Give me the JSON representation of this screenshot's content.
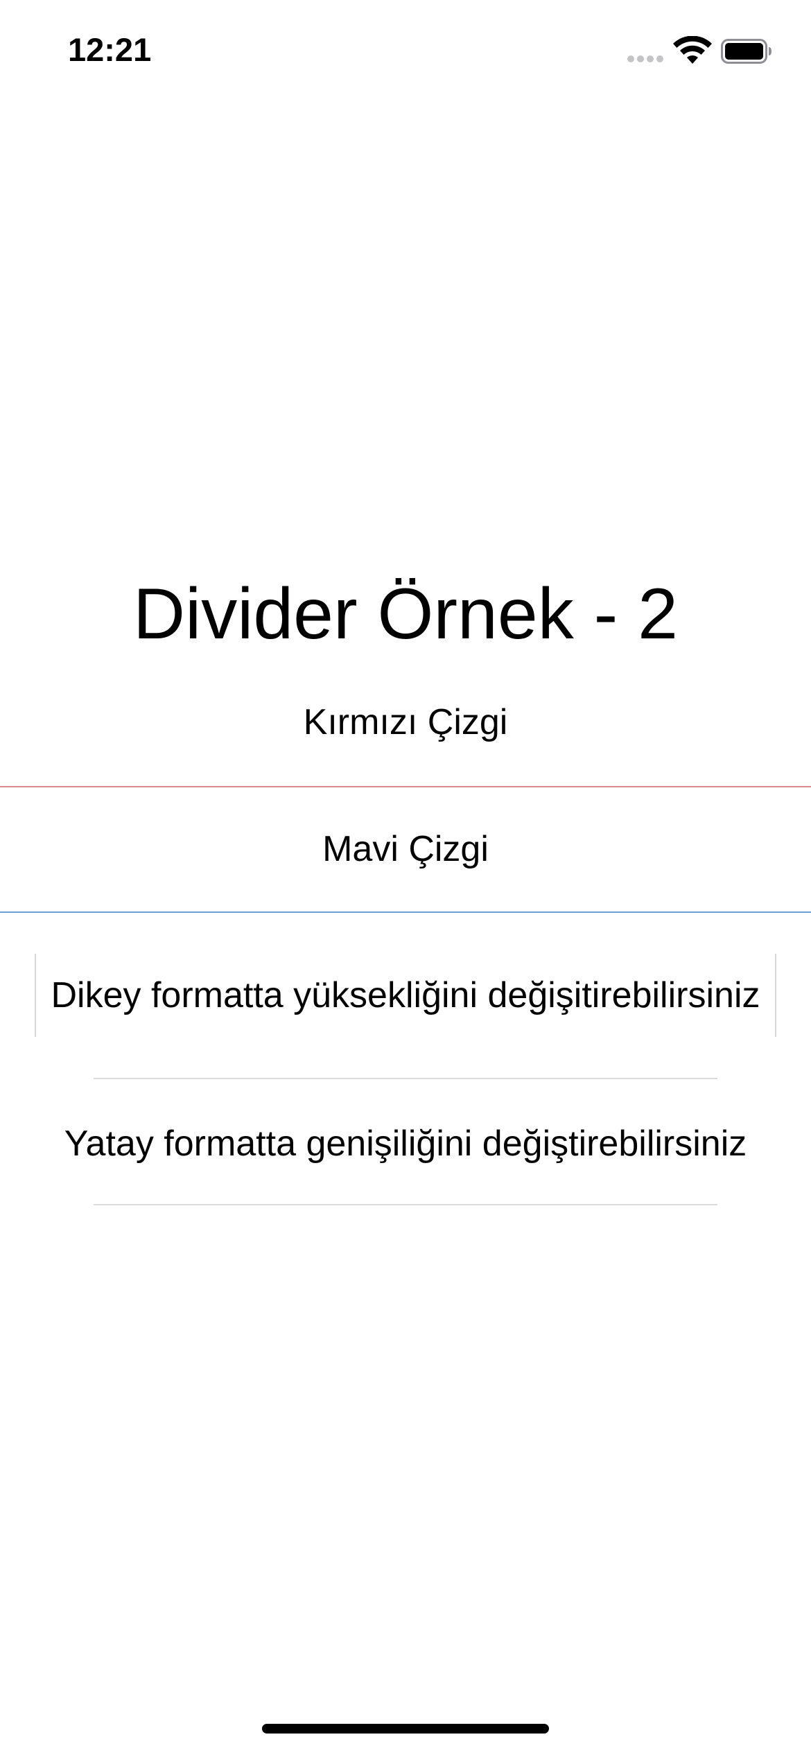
{
  "status_bar": {
    "time": "12:21",
    "icons": [
      "signal-dots-icon",
      "wifi-icon",
      "battery-icon"
    ]
  },
  "main": {
    "title": "Divider Örnek - 2",
    "red_label": "Kırmızı Çizgi",
    "blue_label": "Mavi Çizgi",
    "vertical_label": "Dikey formatta yüksekliğini değişitirebilirsiniz",
    "horizontal_label": "Yatay formatta genişiliğini değiştirebilirsiniz"
  },
  "colors": {
    "red_divider": "#d9898c",
    "blue_divider": "#6b9be0",
    "gray_divider": "#dcdcde"
  }
}
